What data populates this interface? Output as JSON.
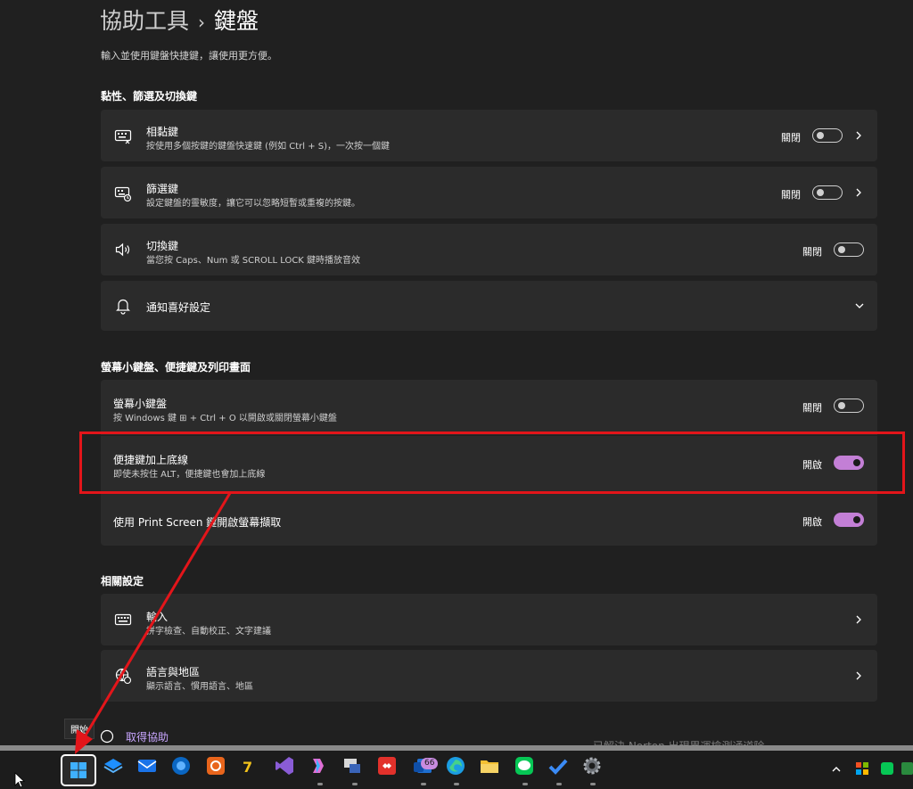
{
  "header": {
    "crumb_parent": "協助工具",
    "crumb_sep": "›",
    "crumb_current": "鍵盤",
    "subtitle": "輸入並使用鍵盤快捷鍵，讓使用更方便。"
  },
  "section1": {
    "heading": "黏性、篩選及切換鍵",
    "items": [
      {
        "label": "相黏鍵",
        "desc": "按使用多個按鍵的鍵盤快速鍵 (例如 Ctrl + S)，一次按一個鍵",
        "state": "關閉"
      },
      {
        "label": "篩選鍵",
        "desc": "設定鍵盤的靈敏度，讓它可以忽略短暫或重複的按鍵。",
        "state": "關閉"
      },
      {
        "label": "切換鍵",
        "desc": "當您按 Caps、Num 或 SCROLL LOCK 鍵時播放音效",
        "state": "關閉"
      },
      {
        "label": "通知喜好設定"
      }
    ]
  },
  "section2": {
    "heading": "螢幕小鍵盤、便捷鍵及列印畫面",
    "items": [
      {
        "label": "螢幕小鍵盤",
        "desc": "按 Windows 鍵 ⊞ + Ctrl + O 以開啟或關閉螢幕小鍵盤",
        "state": "關閉"
      },
      {
        "label": "便捷鍵加上底線",
        "desc": "即使未按住 ALT，便捷鍵也會加上底線",
        "state": "開啟"
      },
      {
        "label": "使用 Print Screen 鍵開啟螢幕擷取",
        "state": "開啟"
      }
    ]
  },
  "section3": {
    "heading": "相關設定",
    "items": [
      {
        "label": "輸入",
        "desc": "拼字檢查、自動校正、文字建議"
      },
      {
        "label": "語言與地區",
        "desc": "顯示語言、慣用語言、地區"
      }
    ]
  },
  "footer": {
    "help_link": "取得協助",
    "tooltip": "開始",
    "behind_text": "已解決 Norton 出現異運檢測通道除，"
  },
  "taskbar": {
    "badge": "66"
  },
  "colors": {
    "accent": "#c37fd6",
    "annotation": "#e3151a",
    "card": "#2b2b2b",
    "background": "#202020"
  }
}
